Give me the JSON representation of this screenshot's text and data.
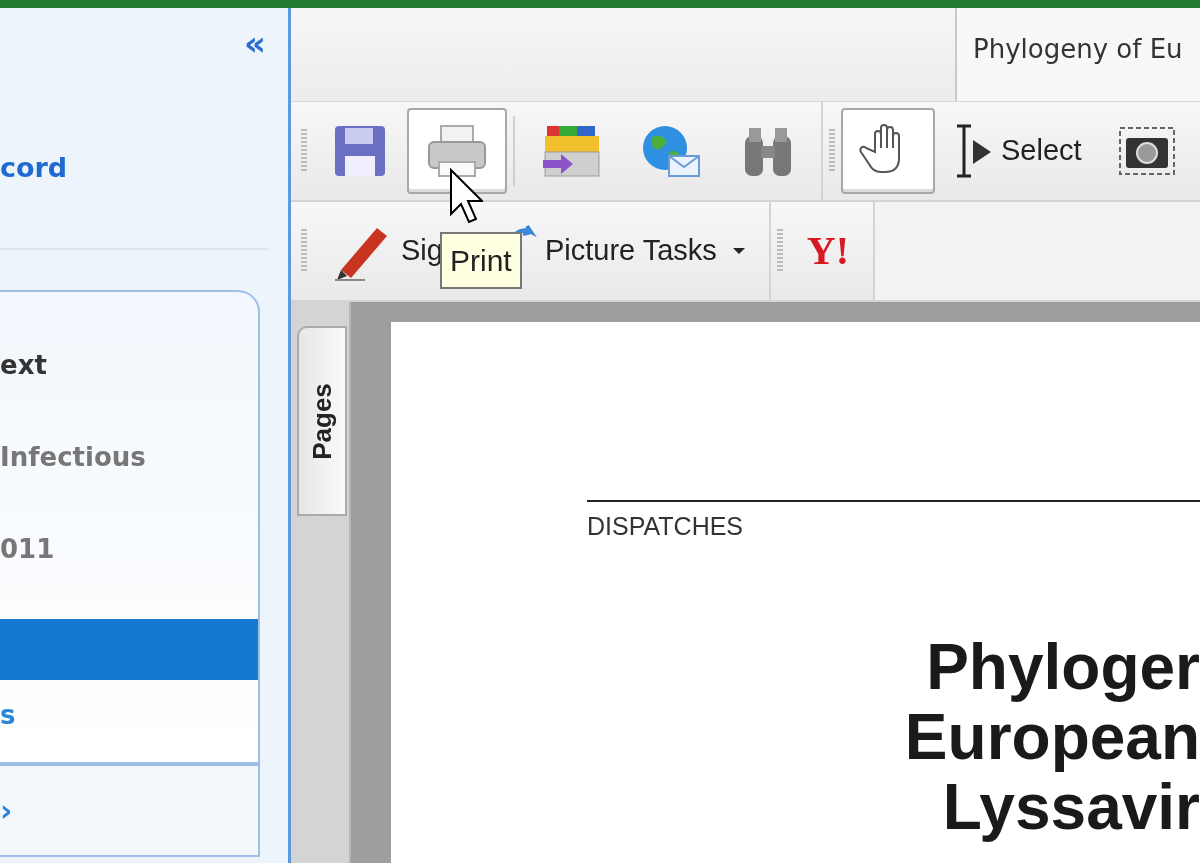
{
  "sidebar": {
    "collapse": "«",
    "link": "cord",
    "items": [
      {
        "label": "ext",
        "kind": "heading",
        "selected": false
      },
      {
        "label": "Infectious",
        "kind": "plain",
        "selected": false
      },
      {
        "label": "011",
        "kind": "plain",
        "selected": false
      },
      {
        "kind": "plain",
        "selected": true
      },
      {
        "label": "s",
        "kind": "link",
        "selected": false
      }
    ],
    "footer": "›"
  },
  "document_tab": {
    "title": "Phylogeny of Eu"
  },
  "toolbar_rows": [
    {
      "groups": [
        {
          "tools": [
            {
              "kind": "save",
              "pressed": false
            },
            {
              "kind": "print",
              "pressed": true
            },
            {
              "kind": "separator"
            },
            {
              "kind": "organizer",
              "pressed": false
            },
            {
              "kind": "email",
              "pressed": false
            },
            {
              "kind": "search",
              "pressed": false
            }
          ]
        },
        {
          "tools": [
            {
              "kind": "hand",
              "pressed": true
            },
            {
              "kind": "select",
              "label": "Select",
              "pressed": false
            },
            {
              "kind": "snapshot",
              "pressed": false
            }
          ]
        }
      ]
    },
    {
      "groups": [
        {
          "tools": [
            {
              "kind": "sign",
              "label": "Sig",
              "pressed": false
            },
            {
              "kind": "picture",
              "label": "Picture Tasks",
              "dropdown": true,
              "pressed": false
            }
          ]
        },
        {
          "tools": [
            {
              "kind": "yahoo",
              "label": "Y!"
            }
          ]
        }
      ]
    }
  ],
  "tooltip": "Print",
  "side_tab": "Pages",
  "page": {
    "section": "DISPATCHES",
    "title_lines": [
      "Phyloger",
      "European",
      "Lyssavir"
    ]
  }
}
